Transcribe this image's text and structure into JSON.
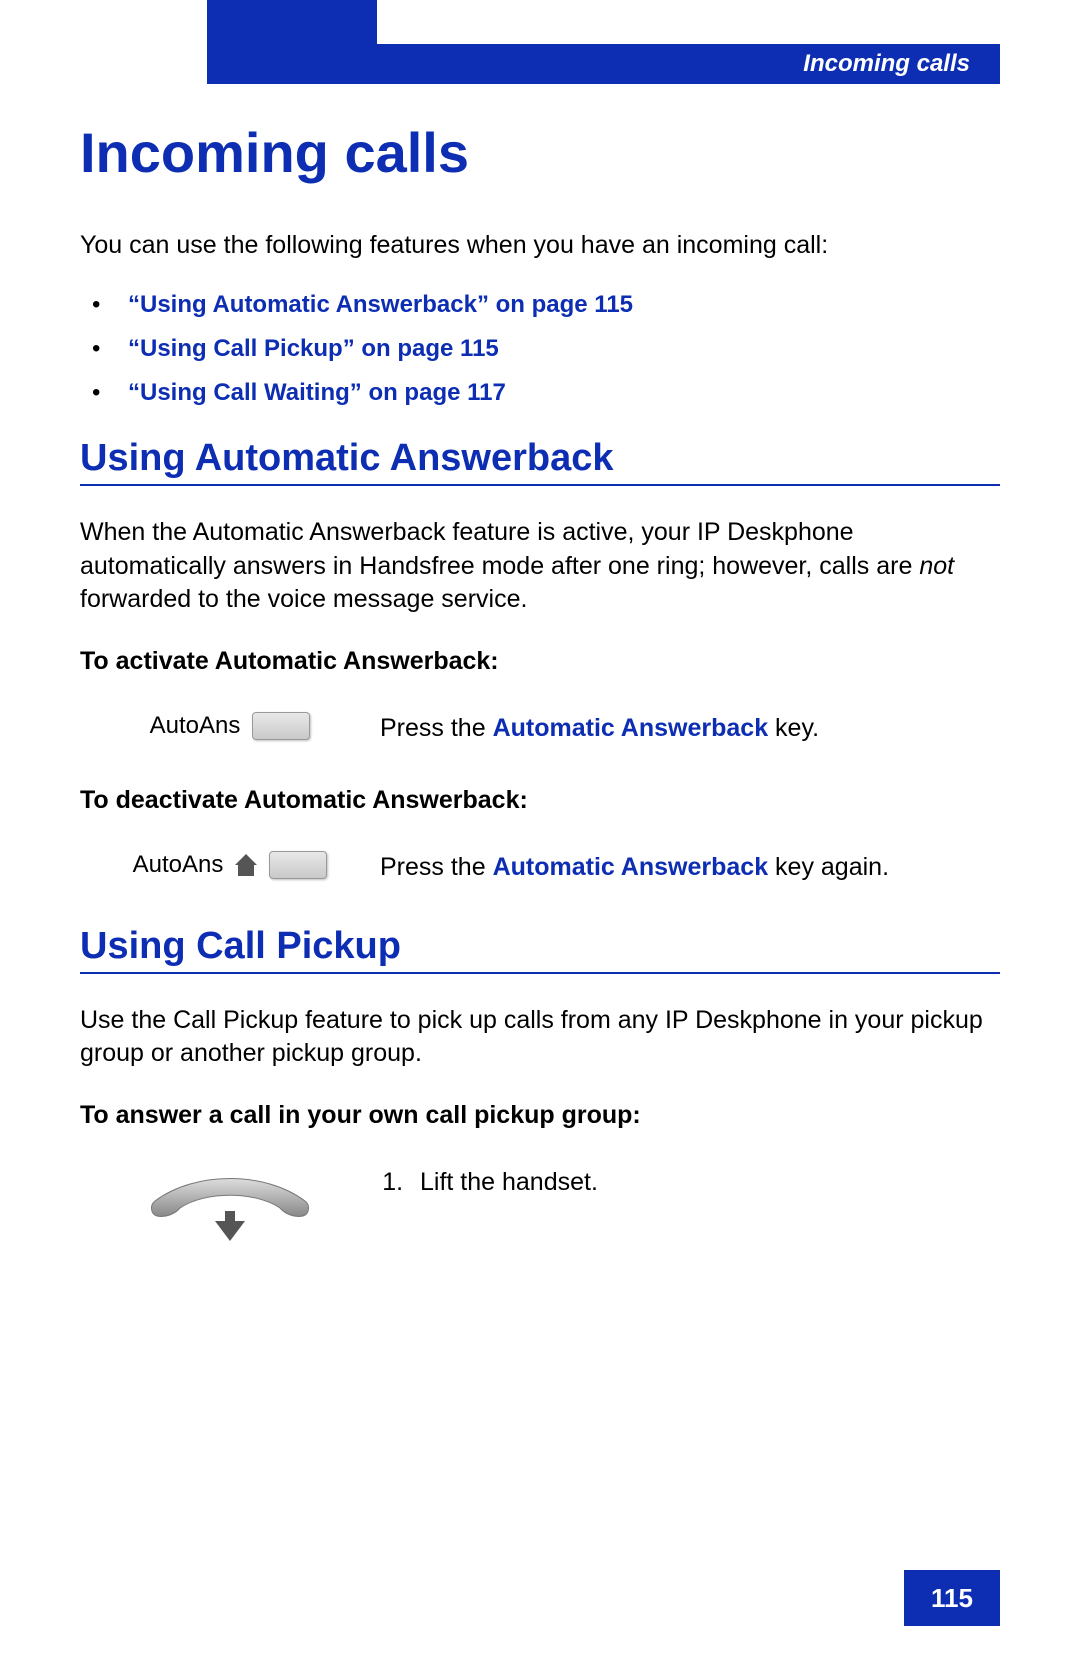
{
  "header": {
    "section": "Incoming calls"
  },
  "title": "Incoming calls",
  "intro": "You can use the following features when you have an incoming call:",
  "links": [
    "“Using Automatic Answerback” on page 115",
    "“Using Call Pickup” on page 115",
    "“Using Call Waiting” on page 117"
  ],
  "section1": {
    "heading": "Using Automatic Answerback",
    "body_pre": "When the Automatic Answerback feature is active, your IP Deskphone automatically answers in Handsfree mode after one ring; however, calls are ",
    "body_em": "not",
    "body_post": " forwarded to the voice message service.",
    "activate_lead": "To activate Automatic Answerback:",
    "activate_label": "AutoAns",
    "activate_text_pre": "Press the ",
    "activate_kw": "Automatic Answerback",
    "activate_text_post": " key.",
    "deactivate_lead": "To deactivate Automatic Answerback:",
    "deactivate_label": "AutoAns",
    "deactivate_text_pre": "Press the ",
    "deactivate_kw": "Automatic Answerback",
    "deactivate_text_post": " key again."
  },
  "section2": {
    "heading": "Using Call Pickup",
    "body": "Use the Call Pickup feature to pick up calls from any IP Deskphone in your pickup group or another pickup group.",
    "lead": "To answer a call in your own call pickup group:",
    "step1": "Lift the handset."
  },
  "page_number": "115"
}
